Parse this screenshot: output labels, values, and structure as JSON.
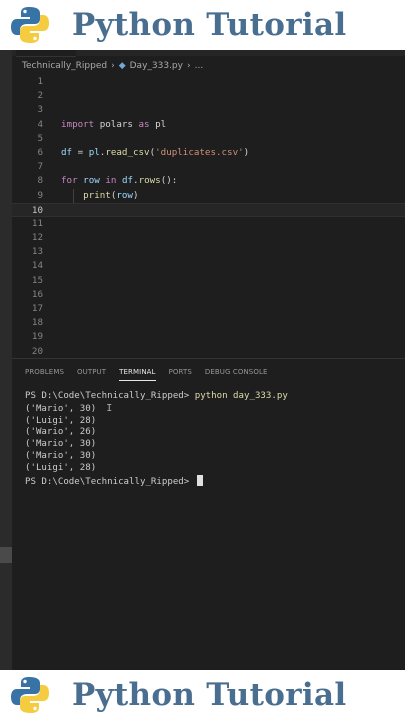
{
  "banner": {
    "title": "Python Tutorial"
  },
  "editor": {
    "breadcrumb": {
      "folder": "Technically_Ripped",
      "file": "Day_333.py",
      "trail": "..."
    },
    "lines": [
      {
        "num": "1",
        "tokens": []
      },
      {
        "num": "2",
        "tokens": []
      },
      {
        "num": "3",
        "tokens": []
      },
      {
        "num": "4",
        "tokens": [
          {
            "t": "import",
            "c": "imp"
          },
          {
            "t": " polars ",
            "c": ""
          },
          {
            "t": "as",
            "c": "imp"
          },
          {
            "t": " pl",
            "c": ""
          }
        ]
      },
      {
        "num": "5",
        "tokens": []
      },
      {
        "num": "6",
        "tokens": [
          {
            "t": "df",
            "c": "var"
          },
          {
            "t": " = ",
            "c": ""
          },
          {
            "t": "pl",
            "c": "var"
          },
          {
            "t": ".",
            "c": ""
          },
          {
            "t": "read_csv",
            "c": "fn"
          },
          {
            "t": "(",
            "c": ""
          },
          {
            "t": "'duplicates.csv'",
            "c": "str"
          },
          {
            "t": ")",
            "c": ""
          }
        ]
      },
      {
        "num": "7",
        "tokens": []
      },
      {
        "num": "8",
        "tokens": [
          {
            "t": "for",
            "c": "kw"
          },
          {
            "t": " ",
            "c": ""
          },
          {
            "t": "row",
            "c": "var"
          },
          {
            "t": " ",
            "c": ""
          },
          {
            "t": "in",
            "c": "kw"
          },
          {
            "t": " ",
            "c": ""
          },
          {
            "t": "df",
            "c": "var"
          },
          {
            "t": ".",
            "c": ""
          },
          {
            "t": "rows",
            "c": "fn"
          },
          {
            "t": "():",
            "c": ""
          }
        ]
      },
      {
        "num": "9",
        "tokens": [
          {
            "t": "    ",
            "c": ""
          },
          {
            "t": "print",
            "c": "fn"
          },
          {
            "t": "(",
            "c": ""
          },
          {
            "t": "row",
            "c": "var"
          },
          {
            "t": ")",
            "c": ""
          }
        ]
      },
      {
        "num": "10",
        "tokens": [],
        "current": true
      },
      {
        "num": "11",
        "tokens": []
      },
      {
        "num": "12",
        "tokens": []
      },
      {
        "num": "13",
        "tokens": []
      },
      {
        "num": "14",
        "tokens": []
      },
      {
        "num": "15",
        "tokens": []
      },
      {
        "num": "16",
        "tokens": []
      },
      {
        "num": "17",
        "tokens": []
      },
      {
        "num": "18",
        "tokens": []
      },
      {
        "num": "19",
        "tokens": []
      },
      {
        "num": "20",
        "tokens": []
      }
    ]
  },
  "panel": {
    "tabs": [
      {
        "label": "PROBLEMS",
        "active": false
      },
      {
        "label": "OUTPUT",
        "active": false
      },
      {
        "label": "TERMINAL",
        "active": true
      },
      {
        "label": "PORTS",
        "active": false
      },
      {
        "label": "DEBUG CONSOLE",
        "active": false
      }
    ],
    "terminal": {
      "prompt": "PS D:\\Code\\Technically_Ripped> ",
      "command": "python day_333.py",
      "output": [
        "('Mario', 30)",
        "('Luigi', 28)",
        "('Wario', 26)",
        "('Mario', 30)",
        "('Mario', 30)",
        "('Luigi', 28)"
      ],
      "final_prompt": "PS D:\\Code\\Technically_Ripped> "
    }
  },
  "colors": {
    "banner_text": "#4a6e90",
    "python_blue": "#3873a6",
    "python_yellow": "#f5cb3f"
  }
}
